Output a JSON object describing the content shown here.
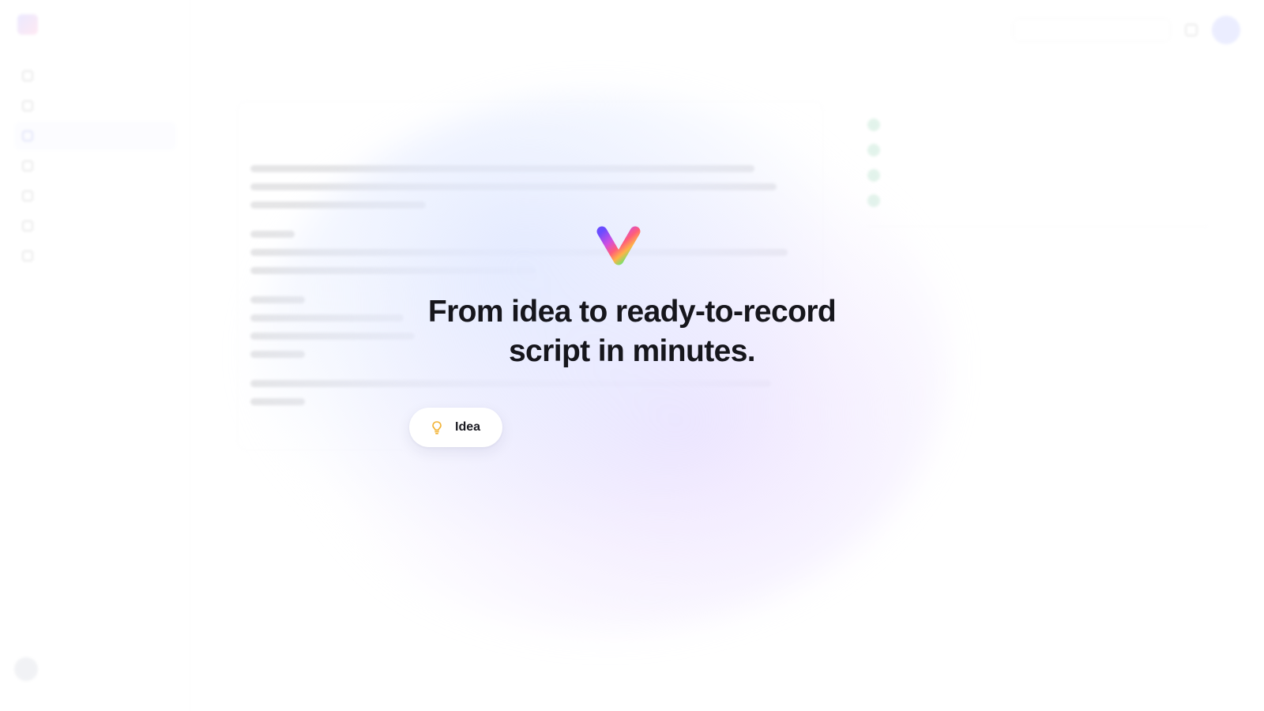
{
  "hero": {
    "headline_line1": "From idea to ready-to-record",
    "headline_line2": "script in minutes.",
    "logo_icon": "gradient-v-logo-icon",
    "logo_gradient": [
      "#6a4cff",
      "#d04ee0",
      "#ff5c7a",
      "#ffb347",
      "#7ee06a",
      "#3fd0c8"
    ]
  },
  "chip": {
    "label": "Idea",
    "icon": "lightbulb-icon",
    "icon_color": "#f2b233"
  },
  "colors": {
    "headline": "#16161c",
    "glow_blue": "#e0e8ff",
    "glow_purple": "#ece2ff"
  }
}
